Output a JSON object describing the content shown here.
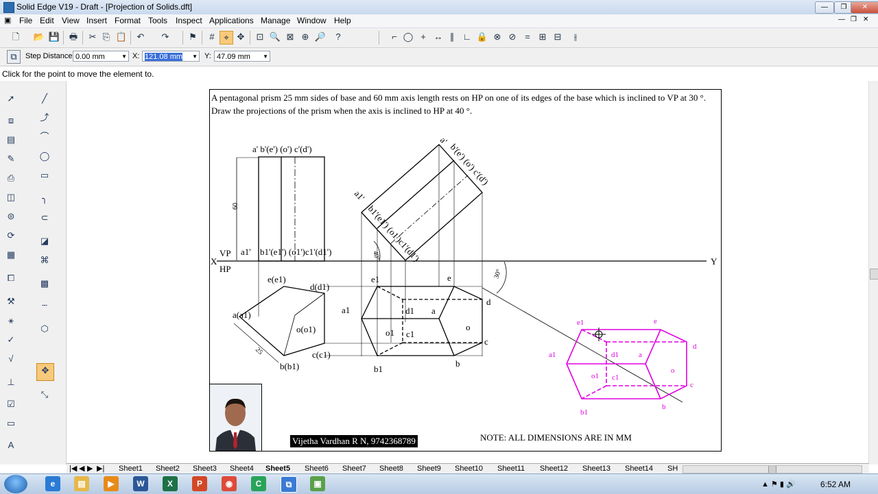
{
  "window": {
    "title": "Solid Edge V19 - Draft - [Projection of Solids.dft]"
  },
  "menu": [
    "File",
    "Edit",
    "View",
    "Insert",
    "Format",
    "Tools",
    "Inspect",
    "Applications",
    "Manage",
    "Window",
    "Help"
  ],
  "ribbon": {
    "step_distance_label": "Step Distance:",
    "step_distance_value": "0.00 mm",
    "x_label": "X:",
    "x_value": "121.08 mm",
    "y_label": "Y:",
    "y_value": "47.09 mm"
  },
  "status": "Click for the point to move the element to.",
  "drawing": {
    "problem": "A pentagonal prism 25 mm sides of base and 60 mm axis length rests on HP on one of its edges of the base which is inclined to VP at 30 °. Draw the projections of the prism when the axis is inclined to HP at 40 °.",
    "note": "NOTE: ALL DIMENSIONS ARE IN MM",
    "author": "Vijetha Vardhan R N, 9742368789",
    "labels": {
      "top_front": "a'  b'(e') (o') c'(d')",
      "bottom_front": "b1'(e1') (o1')c1'(d1')",
      "a1p": "a1'",
      "vp": "VP",
      "hp": "HP",
      "x": "X",
      "y": "Y",
      "dim60": "60",
      "dim25": "25",
      "dim40": "40°",
      "dim30": "30°",
      "e_e1": "e(e1)",
      "d_d1": "d(d1)",
      "a_a1": "a(a1)",
      "o_o1": "o(o1)",
      "b_b1": "b(b1)",
      "c_c1": "c(c1)",
      "tilted_a": "a'",
      "tilted_top": "b'(e') (o') c'(d')",
      "tilted_a1": "a1'",
      "tilted_bottom": "b1'(e1') (o1')c1'(d1')",
      "tv_e1": "e1",
      "tv_e": "e",
      "tv_d": "d",
      "tv_a1": "a1",
      "tv_d1": "d1",
      "tv_a": "a",
      "tv_o1": "o1",
      "tv_c1": "c1",
      "tv_o": "o",
      "tv_c": "c",
      "tv_b1": "b1",
      "tv_b": "b",
      "m_e1": "e1",
      "m_e": "e",
      "m_d": "d",
      "m_a1": "a1",
      "m_d1": "d1",
      "m_a": "a",
      "m_o1": "o1",
      "m_c1": "c1",
      "m_o": "o",
      "m_c": "c",
      "m_b": "b",
      "m_b1": "b1"
    }
  },
  "sheets": [
    "Sheet1",
    "Sheet2",
    "Sheet3",
    "Sheet4",
    "Sheet5",
    "Sheet6",
    "Sheet7",
    "Sheet8",
    "Sheet9",
    "Sheet10",
    "Sheet11",
    "Sheet12",
    "Sheet13",
    "Sheet14",
    "SH"
  ],
  "active_sheet": "Sheet5",
  "clock": "6:52 AM",
  "colors": {
    "accent_magenta": "#e000e0",
    "selection": "#3a6fd8"
  }
}
